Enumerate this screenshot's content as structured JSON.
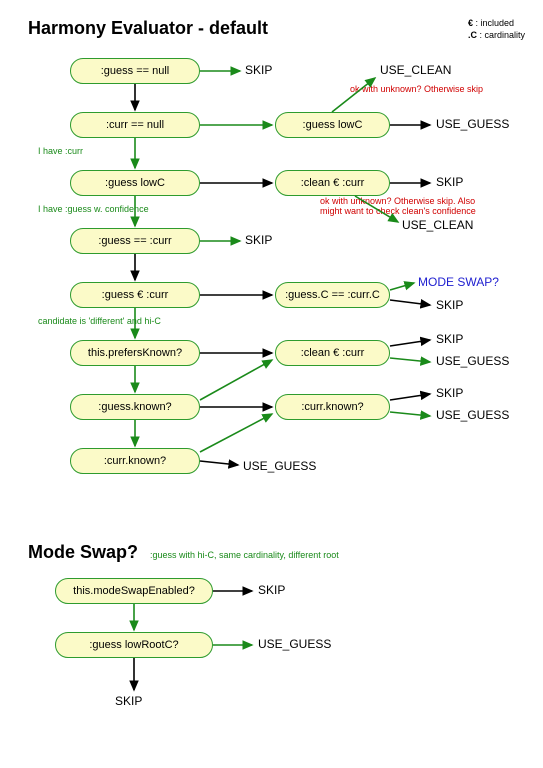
{
  "titles": {
    "main": "Harmony Evaluator - default",
    "mode_swap": "Mode Swap?"
  },
  "legend": {
    "l1_symbol": "€",
    "l1_text": " : included",
    "l2_symbol": ".C",
    "l2_text": " : cardinality"
  },
  "nodes": {
    "n1": ":guess == null",
    "n2": ":curr == null",
    "n2b": ":guess lowC",
    "n3": ":guess lowC",
    "n3b": ":clean € :curr",
    "n4": ":guess == :curr",
    "n5": ":guess € :curr",
    "n5b": ":guess.C == :curr.C",
    "n6": "this.prefersKnown?",
    "n6b": ":clean € :curr",
    "n7": ":guess.known?",
    "n7b": ":curr.known?",
    "n8": ":curr.known?",
    "m1": "this.modeSwapEnabled?",
    "m2": ":guess  lowRootC?"
  },
  "outcomes": {
    "skip": "SKIP",
    "use_clean": "USE_CLEAN",
    "use_guess": "USE_GUESS",
    "mode_swap": "MODE  SWAP?"
  },
  "notes": {
    "r1": "ok with unknown? Otherwise skip",
    "r2a": "ok with unknown? Otherwise skip. Also",
    "r2b": "might want to check clean's confidence",
    "g1": "I have :curr",
    "g2": "I have :guess w. confidence",
    "g3": "candidate is 'different' and hi-C",
    "ms_sub": ":guess with hi-C, same cardinality, different root"
  }
}
